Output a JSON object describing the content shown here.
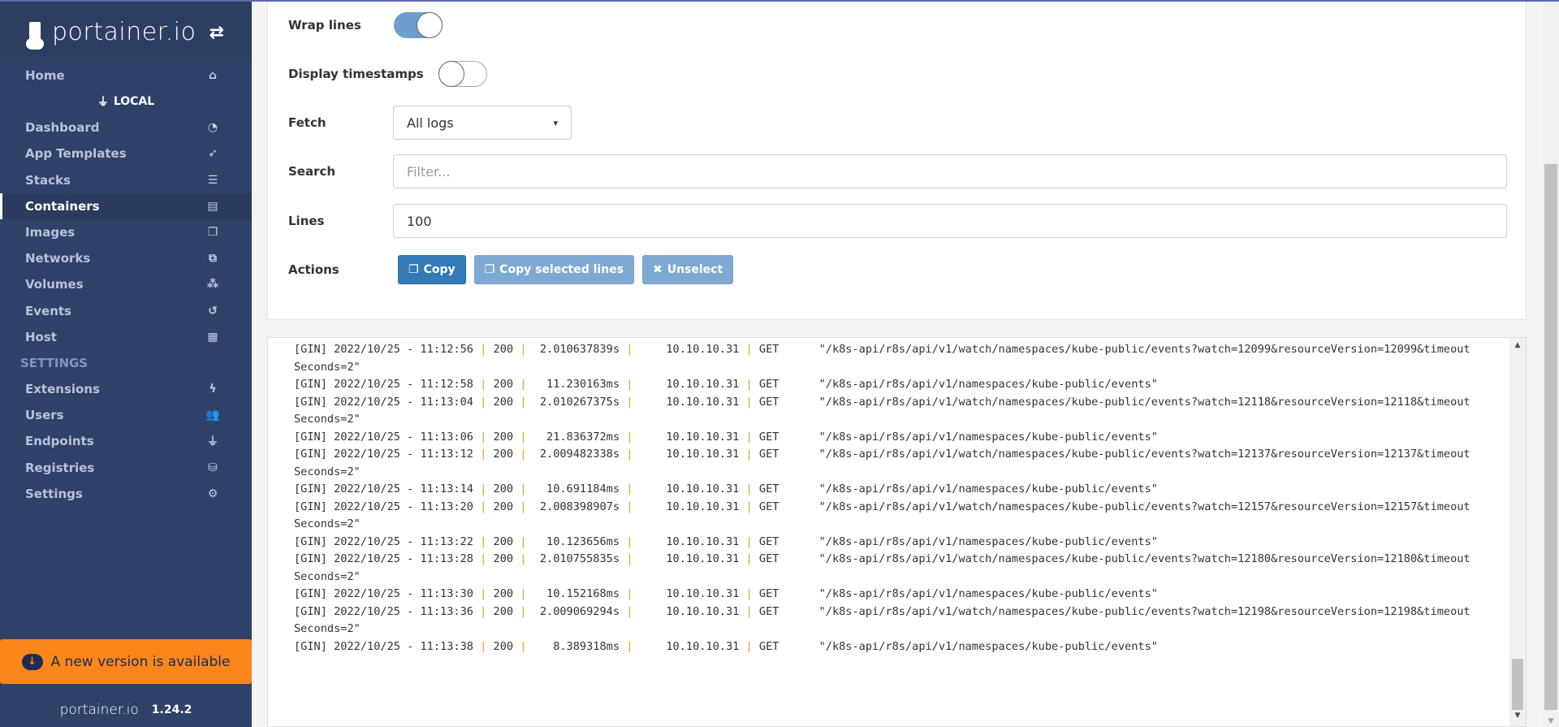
{
  "sidebar": {
    "brand": "portainer.io",
    "home": {
      "label": "Home",
      "icon": "home-icon"
    },
    "endpoint": "LOCAL",
    "items": [
      {
        "label": "Dashboard",
        "icon": "tachometer-icon",
        "glyph": "◔"
      },
      {
        "label": "App Templates",
        "icon": "rocket-icon",
        "glyph": "➶"
      },
      {
        "label": "Stacks",
        "icon": "th-list-icon",
        "glyph": "☰"
      },
      {
        "label": "Containers",
        "icon": "server-icon",
        "glyph": "▤",
        "active": true
      },
      {
        "label": "Images",
        "icon": "clone-icon",
        "glyph": "❐"
      },
      {
        "label": "Networks",
        "icon": "sitemap-icon",
        "glyph": "⧉"
      },
      {
        "label": "Volumes",
        "icon": "cubes-icon",
        "glyph": "⁂"
      },
      {
        "label": "Events",
        "icon": "history-icon",
        "glyph": "↺"
      },
      {
        "label": "Host",
        "icon": "th-icon",
        "glyph": "▦"
      }
    ],
    "settings_header": "SETTINGS",
    "settings_items": [
      {
        "label": "Extensions",
        "icon": "bolt-icon",
        "glyph": "ϟ"
      },
      {
        "label": "Users",
        "icon": "users-icon",
        "glyph": "👥"
      },
      {
        "label": "Endpoints",
        "icon": "plug-icon",
        "glyph": "⏚"
      },
      {
        "label": "Registries",
        "icon": "database-icon",
        "glyph": "⛁"
      },
      {
        "label": "Settings",
        "icon": "cogs-icon",
        "glyph": "⚙"
      }
    ],
    "update_banner": "A new version is available",
    "footer_brand": "portainer.io",
    "version": "1.24.2"
  },
  "log_settings": {
    "wrap_label": "Wrap lines",
    "wrap_on": true,
    "timestamps_label": "Display timestamps",
    "timestamps_on": false,
    "fetch_label": "Fetch",
    "fetch_value": "All logs",
    "search_label": "Search",
    "search_placeholder": "Filter...",
    "lines_label": "Lines",
    "lines_value": "100",
    "actions_label": "Actions",
    "copy": "Copy",
    "copy_selected": "Copy selected lines",
    "unselect": "Unselect"
  },
  "colors": {
    "sidebar": "#30426a",
    "banner": "#fa861c",
    "primary": "#337ab7",
    "pipe": "#e6a117"
  },
  "logs": [
    "[GIN] 2022/10/25 - 11:12:56 | 200 |  2.010637839s |     10.10.10.31 | GET      \"/k8s-api/r8s/api/v1/watch/namespaces/kube-public/events?watch=12099&resourceVersion=12099&timeoutSeconds=2\"",
    "[GIN] 2022/10/25 - 11:12:58 | 200 |   11.230163ms |     10.10.10.31 | GET      \"/k8s-api/r8s/api/v1/namespaces/kube-public/events\"",
    "[GIN] 2022/10/25 - 11:13:04 | 200 |  2.010267375s |     10.10.10.31 | GET      \"/k8s-api/r8s/api/v1/watch/namespaces/kube-public/events?watch=12118&resourceVersion=12118&timeoutSeconds=2\"",
    "[GIN] 2022/10/25 - 11:13:06 | 200 |   21.836372ms |     10.10.10.31 | GET      \"/k8s-api/r8s/api/v1/namespaces/kube-public/events\"",
    "[GIN] 2022/10/25 - 11:13:12 | 200 |  2.009482338s |     10.10.10.31 | GET      \"/k8s-api/r8s/api/v1/watch/namespaces/kube-public/events?watch=12137&resourceVersion=12137&timeoutSeconds=2\"",
    "[GIN] 2022/10/25 - 11:13:14 | 200 |   10.691184ms |     10.10.10.31 | GET      \"/k8s-api/r8s/api/v1/namespaces/kube-public/events\"",
    "[GIN] 2022/10/25 - 11:13:20 | 200 |  2.008398907s |     10.10.10.31 | GET      \"/k8s-api/r8s/api/v1/watch/namespaces/kube-public/events?watch=12157&resourceVersion=12157&timeoutSeconds=2\"",
    "[GIN] 2022/10/25 - 11:13:22 | 200 |   10.123656ms |     10.10.10.31 | GET      \"/k8s-api/r8s/api/v1/namespaces/kube-public/events\"",
    "[GIN] 2022/10/25 - 11:13:28 | 200 |  2.010755835s |     10.10.10.31 | GET      \"/k8s-api/r8s/api/v1/watch/namespaces/kube-public/events?watch=12180&resourceVersion=12180&timeoutSeconds=2\"",
    "[GIN] 2022/10/25 - 11:13:30 | 200 |   10.152168ms |     10.10.10.31 | GET      \"/k8s-api/r8s/api/v1/namespaces/kube-public/events\"",
    "[GIN] 2022/10/25 - 11:13:36 | 200 |  2.009069294s |     10.10.10.31 | GET      \"/k8s-api/r8s/api/v1/watch/namespaces/kube-public/events?watch=12198&resourceVersion=12198&timeoutSeconds=2\"",
    "[GIN] 2022/10/25 - 11:13:38 | 200 |    8.389318ms |     10.10.10.31 | GET      \"/k8s-api/r8s/api/v1/namespaces/kube-public/events\""
  ]
}
